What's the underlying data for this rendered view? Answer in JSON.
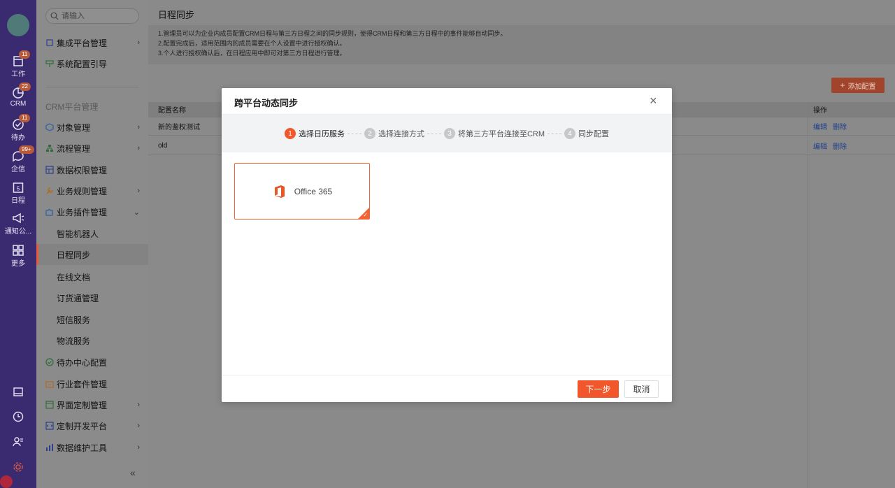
{
  "rail": {
    "items": [
      {
        "label": "工作",
        "badge": "11",
        "icon": "clipboard-icon"
      },
      {
        "label": "CRM",
        "badge": "22",
        "icon": "chart-pie-icon"
      },
      {
        "label": "待办",
        "badge": "11",
        "icon": "check-circle-icon"
      },
      {
        "label": "企信",
        "badge": "99+",
        "icon": "chat-icon"
      },
      {
        "label": "日程",
        "badge": "",
        "icon": "calendar-icon",
        "day": "5"
      },
      {
        "label": "通知公...",
        "badge": "",
        "icon": "megaphone-icon"
      },
      {
        "label": "更多",
        "badge": "",
        "icon": "grid-icon"
      }
    ]
  },
  "sidebar": {
    "search_placeholder": "请输入",
    "top_items": [
      {
        "label": "集成平台管理"
      },
      {
        "label": "系统配置引导"
      }
    ],
    "section_title": "CRM平台管理",
    "items": [
      {
        "label": "对象管理"
      },
      {
        "label": "流程管理"
      },
      {
        "label": "数据权限管理"
      },
      {
        "label": "业务规则管理"
      },
      {
        "label": "业务插件管理"
      },
      {
        "label": "智能机器人"
      },
      {
        "label": "日程同步"
      },
      {
        "label": "在线文档"
      },
      {
        "label": "订货通管理"
      },
      {
        "label": "短信服务"
      },
      {
        "label": "物流服务"
      },
      {
        "label": "待办中心配置"
      },
      {
        "label": "行业套件管理"
      },
      {
        "label": "界面定制管理"
      },
      {
        "label": "定制开发平台"
      },
      {
        "label": "数据维护工具"
      }
    ],
    "collapse": "«"
  },
  "main": {
    "title": "日程同步",
    "notice": [
      "1.管理员可以为企业内成员配置CRM日程与第三方日程之间的同步规则，使得CRM日程和第三方日程中的事件能够自动同步。",
      "2.配置完成后，适用范围内的成员需要在个人设置中进行授权确认。",
      "3.个人进行授权确认后，在日程应用中即可对第三方日程进行管理。"
    ],
    "add_button": "添加配置",
    "table": {
      "headers": [
        "配置名称",
        "操作"
      ],
      "rows": [
        {
          "name": "新的鉴权测试",
          "edit": "编辑",
          "delete": "删除"
        },
        {
          "name": "old",
          "edit": "编辑",
          "delete": "删除"
        }
      ]
    }
  },
  "modal": {
    "title": "跨平台动态同步",
    "close": "×",
    "steps": [
      {
        "num": "1",
        "label": "选择日历服务"
      },
      {
        "num": "2",
        "label": "选择连接方式"
      },
      {
        "num": "3",
        "label": "将第三方平台连接至CRM"
      },
      {
        "num": "4",
        "label": "同步配置"
      }
    ],
    "service_card": "Office 365",
    "next": "下一步",
    "cancel": "取消"
  },
  "colors": {
    "accent": "#f2572c",
    "rail": "#3a2a70"
  }
}
